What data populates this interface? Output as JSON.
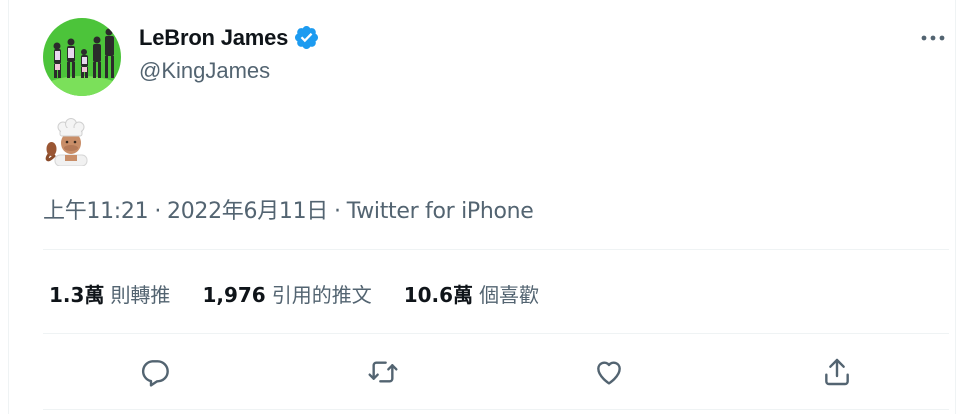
{
  "author": {
    "name": "LeBron James",
    "handle": "@KingJames",
    "verified": true,
    "avatar_bg": "#4cc43a"
  },
  "tweet": {
    "emoji": "cook-emoji",
    "time": "上午11:21",
    "date": "2022年6月11日",
    "separator": "·",
    "source": "Twitter for iPhone"
  },
  "stats": [
    {
      "value": "1.3萬",
      "label": "則轉推"
    },
    {
      "value": "1,976",
      "label": "引用的推文"
    },
    {
      "value": "10.6萬",
      "label": "個喜歡"
    }
  ],
  "actions": [
    "reply-icon",
    "retweet-icon",
    "like-icon",
    "share-icon"
  ],
  "colors": {
    "text": "#0f1419",
    "secondary": "#536471",
    "verified": "#1d9bf0",
    "divider": "#eff3f4"
  }
}
